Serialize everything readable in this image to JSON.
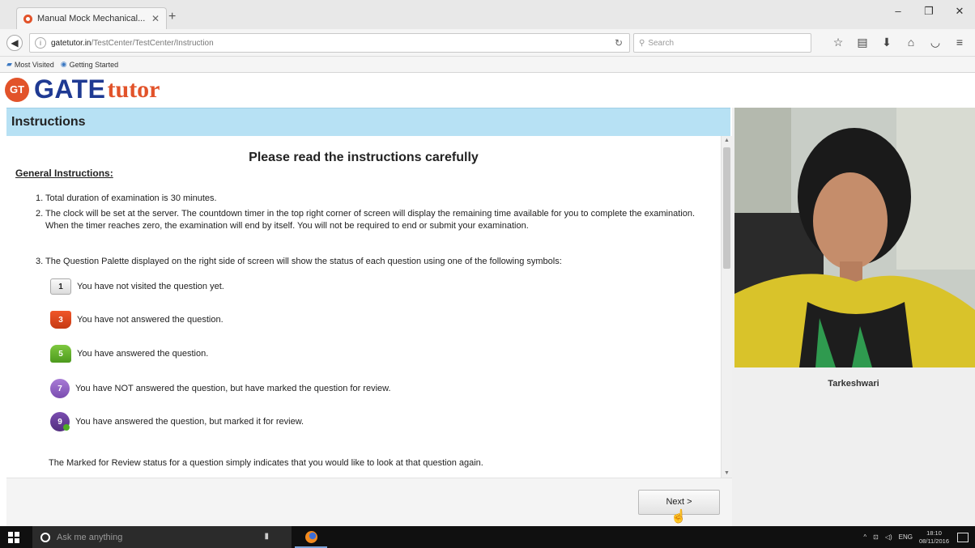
{
  "browser": {
    "tab_title": "Manual Mock Mechanical...",
    "url_host": "gatetutor.in",
    "url_path": "/TestCenter/TestCenter/Instruction",
    "search_placeholder": "Search",
    "bookmarks": [
      "Most Visited",
      "Getting Started"
    ]
  },
  "logo": {
    "badge": "GT",
    "part1": "GATE",
    "part2": "tutor"
  },
  "instructions": {
    "bar_title": "Instructions",
    "heading": "Please read the instructions carefully",
    "general_title": "General Instructions:",
    "items": [
      "1. Total duration of examination is 30 minutes.",
      "2. The clock will be set at the server. The countdown timer in the top right corner of screen will display the remaining time available for you to complete the examination. When the timer reaches zero, the examination will end by itself. You will not be required to end or submit your examination.",
      "3. The Question Palette displayed on the right side of screen will show the status of each question using one of the following symbols:"
    ],
    "legend": [
      {
        "number": "1",
        "text": "You have not visited the question yet."
      },
      {
        "number": "3",
        "text": "You have not answered the question."
      },
      {
        "number": "5",
        "text": "You have answered the question."
      },
      {
        "number": "7",
        "text": "You have NOT answered the question, but have marked the question for review."
      },
      {
        "number": "9",
        "text": "You have answered the question, but marked it for review."
      }
    ],
    "review_note": "The Marked for Review status for a question simply indicates that you would like to look at that question again."
  },
  "buttons": {
    "next": "Next >"
  },
  "candidate": {
    "name": "Tarkeshwari"
  },
  "taskbar": {
    "search_placeholder": "Ask me anything",
    "language": "ENG",
    "time": "18:10",
    "date": "08/11/2016"
  },
  "colors": {
    "instr_bar": "#b7e1f4",
    "brand_orange": "#e2532a",
    "brand_blue": "#1f3a93"
  }
}
